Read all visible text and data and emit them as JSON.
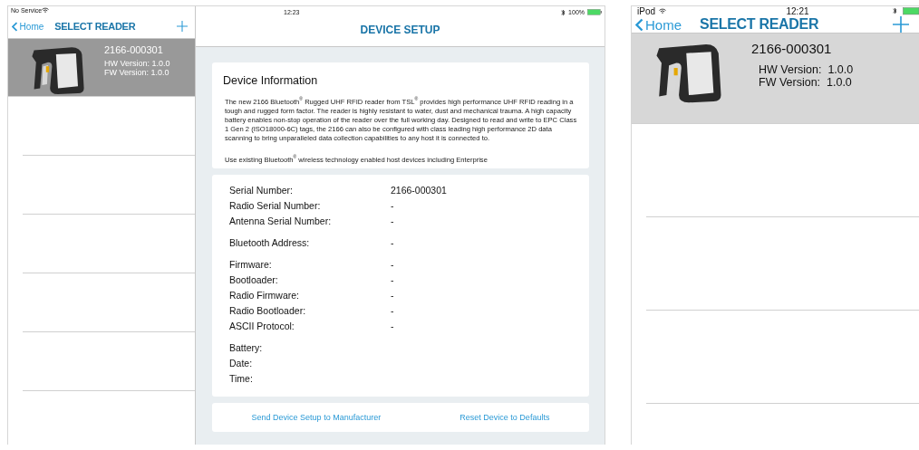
{
  "tablet": {
    "status_bar": {
      "carrier": "No Service",
      "time": "12:23",
      "battery": "100%"
    },
    "sidebar": {
      "back": "Home",
      "title": "SELECT READER",
      "readers": [
        {
          "name": "2166-000301",
          "hw": "HW Version: 1.0.0",
          "fw": "FW Version: 1.0.0",
          "selected": true
        }
      ]
    },
    "detail": {
      "title": "DEVICE SETUP",
      "info": {
        "heading": "Device Information",
        "paragraphs": [
          "The new 2166 Bluetooth$^{®}$ Rugged UHF RFID reader from TSL$^{®}$ provides high performance UHF RFID reading in a tough and rugged form factor. The reader is highly resistant to water, dust and mechanical trauma. A high capacity battery enables non-stop operation of the reader over the full working day. Designed to read and write to EPC Class 1 Gen 2 (ISO18000-6C) tags, the 2166 can also be configured with class leading high performance 2D data scanning to bring unparalleled data collection capabilities to any host it is connected to.",
          "Use existing Bluetooth$^{®}$ wireless technology enabled host devices including Enterprise"
        ]
      },
      "field_groups": [
        [
          {
            "label": "Serial Number:",
            "value": "2166-000301"
          },
          {
            "label": "Radio Serial Number:",
            "value": "-"
          },
          {
            "label": "Antenna Serial Number:",
            "value": "-"
          }
        ],
        [
          {
            "label": "Bluetooth Address:",
            "value": "-"
          }
        ],
        [
          {
            "label": "Firmware:",
            "value": "-"
          },
          {
            "label": "Bootloader:",
            "value": "-"
          },
          {
            "label": "Radio Firmware:",
            "value": "-"
          },
          {
            "label": "Radio Bootloader:",
            "value": "-"
          },
          {
            "label": "ASCII Protocol:",
            "value": "-"
          }
        ],
        [
          {
            "label": "Battery:"
          },
          {
            "label": "Date:"
          },
          {
            "label": "Time:"
          }
        ]
      ],
      "actions": [
        "Send Device Setup to Manufacturer",
        "Reset Device to Defaults"
      ]
    }
  },
  "phone": {
    "status_bar": {
      "carrier": "iPod",
      "time": "12:21"
    },
    "back": "Home",
    "title": "SELECT READER",
    "readers": [
      {
        "name": "2166-000301",
        "hw": "HW Version:  1.0.0",
        "fw": "FW Version:  1.0.0",
        "selected": true
      }
    ]
  }
}
